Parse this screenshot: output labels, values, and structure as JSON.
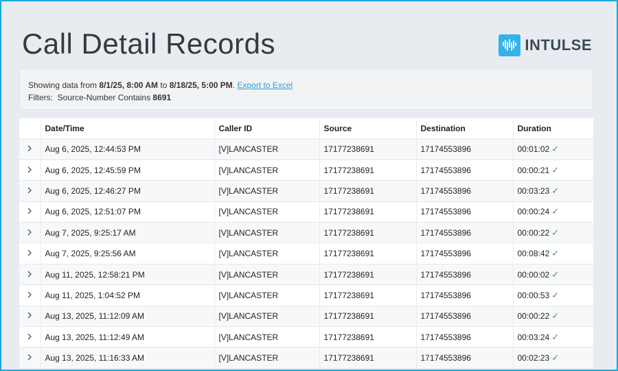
{
  "page": {
    "title": "Call Detail Records"
  },
  "brand": {
    "name": "INTULSE",
    "accent": "#34b3e6"
  },
  "info": {
    "prefix": "Showing data from",
    "start": "8/1/25, 8:00 AM",
    "to": "to",
    "end": "8/18/25, 5:00 PM",
    "period": ".",
    "export_label": "Export to Excel",
    "filters_label": "Filters:",
    "filter_text": "Source-Number Contains",
    "filter_value": "8691"
  },
  "table": {
    "columns": [
      "Date/Time",
      "Caller ID",
      "Source",
      "Destination",
      "Duration"
    ],
    "rows": [
      {
        "datetime": "Aug 6, 2025, 12:44:53 PM",
        "caller": "[V]LANCASTER",
        "source": "17177238691",
        "destination": "17174553896",
        "duration": "00:01:02"
      },
      {
        "datetime": "Aug 6, 2025, 12:45:59 PM",
        "caller": "[V]LANCASTER",
        "source": "17177238691",
        "destination": "17174553896",
        "duration": "00:00:21"
      },
      {
        "datetime": "Aug 6, 2025, 12:46:27 PM",
        "caller": "[V]LANCASTER",
        "source": "17177238691",
        "destination": "17174553896",
        "duration": "00:03:23"
      },
      {
        "datetime": "Aug 6, 2025, 12:51:07 PM",
        "caller": "[V]LANCASTER",
        "source": "17177238691",
        "destination": "17174553896",
        "duration": "00:00:24"
      },
      {
        "datetime": "Aug 7, 2025, 9:25:17 AM",
        "caller": "[V]LANCASTER",
        "source": "17177238691",
        "destination": "17174553896",
        "duration": "00:00:22"
      },
      {
        "datetime": "Aug 7, 2025, 9:25:56 AM",
        "caller": "[V]LANCASTER",
        "source": "17177238691",
        "destination": "17174553896",
        "duration": "00:08:42"
      },
      {
        "datetime": "Aug 11, 2025, 12:58:21 PM",
        "caller": "[V]LANCASTER",
        "source": "17177238691",
        "destination": "17174553896",
        "duration": "00:00:02"
      },
      {
        "datetime": "Aug 11, 2025, 1:04:52 PM",
        "caller": "[V]LANCASTER",
        "source": "17177238691",
        "destination": "17174553896",
        "duration": "00:00:53"
      },
      {
        "datetime": "Aug 13, 2025, 11:12:09 AM",
        "caller": "[V]LANCASTER",
        "source": "17177238691",
        "destination": "17174553896",
        "duration": "00:00:22"
      },
      {
        "datetime": "Aug 13, 2025, 11:12:49 AM",
        "caller": "[V]LANCASTER",
        "source": "17177238691",
        "destination": "17174553896",
        "duration": "00:03:24"
      },
      {
        "datetime": "Aug 13, 2025, 11:16:33 AM",
        "caller": "[V]LANCASTER",
        "source": "17177238691",
        "destination": "17174553896",
        "duration": "00:02:23"
      }
    ],
    "row_status_icon": "check-icon",
    "expand_icon": "chevron-right-icon"
  }
}
